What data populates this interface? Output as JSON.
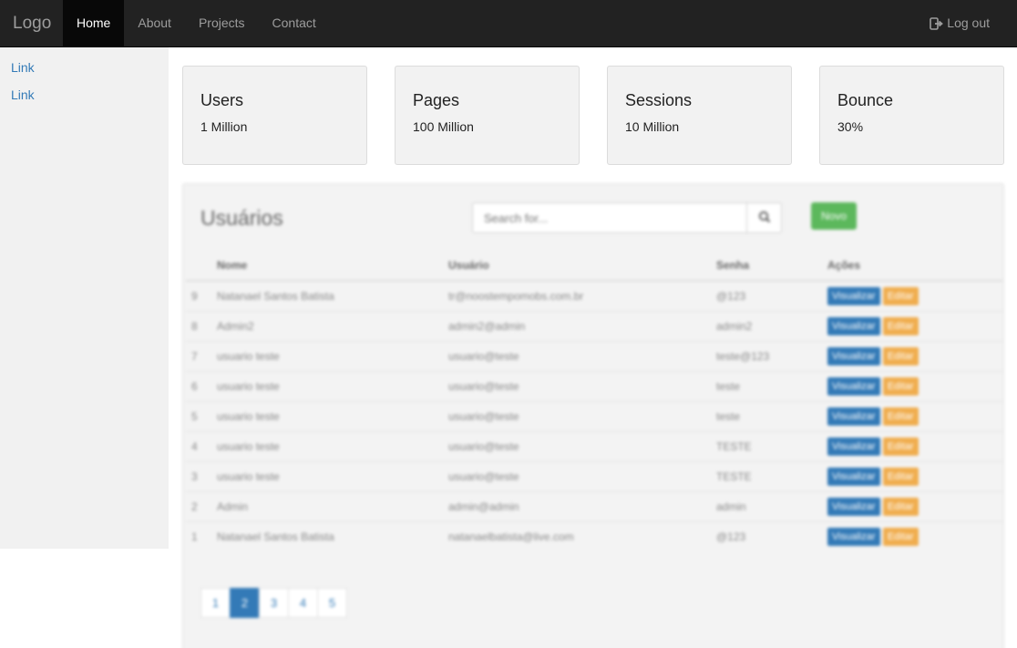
{
  "navbar": {
    "brand": "Logo",
    "items": [
      {
        "label": "Home",
        "active": true
      },
      {
        "label": "About",
        "active": false
      },
      {
        "label": "Projects",
        "active": false
      },
      {
        "label": "Contact",
        "active": false
      }
    ],
    "logout_label": "Log out",
    "logout_icon": "log-out-icon"
  },
  "sidebar": {
    "links": [
      "Link",
      "Link"
    ]
  },
  "stats": [
    {
      "title": "Users",
      "value": "1 Million"
    },
    {
      "title": "Pages",
      "value": "100 Million"
    },
    {
      "title": "Sessions",
      "value": "10 Million"
    },
    {
      "title": "Bounce",
      "value": "30%"
    }
  ],
  "users_panel": {
    "title": "Usuários",
    "search_placeholder": "Search for...",
    "search_icon": "search-icon",
    "new_button": "Novo",
    "columns": [
      "",
      "Nome",
      "Usuário",
      "Senha",
      "Ações"
    ],
    "rows": [
      {
        "id": "9",
        "nome": "Natanael Santos Batista",
        "usuario": "tr@noostempomobs.com.br",
        "senha": "@123"
      },
      {
        "id": "8",
        "nome": "Admin2",
        "usuario": "admin2@admin",
        "senha": "admin2"
      },
      {
        "id": "7",
        "nome": "usuario teste",
        "usuario": "usuario@teste",
        "senha": "teste@123"
      },
      {
        "id": "6",
        "nome": "usuario teste",
        "usuario": "usuario@teste",
        "senha": "teste"
      },
      {
        "id": "5",
        "nome": "usuario teste",
        "usuario": "usuario@teste",
        "senha": "teste"
      },
      {
        "id": "4",
        "nome": "usuario teste",
        "usuario": "usuario@teste",
        "senha": "TESTE"
      },
      {
        "id": "3",
        "nome": "usuario teste",
        "usuario": "usuario@teste",
        "senha": "TESTE"
      },
      {
        "id": "2",
        "nome": "Admin",
        "usuario": "admin@admin",
        "senha": "admin"
      },
      {
        "id": "1",
        "nome": "Natanael Santos Batista",
        "usuario": "natanaelbatista@live.com",
        "senha": "@123"
      }
    ],
    "actions": {
      "view": "Visualizar",
      "edit": "Editar"
    },
    "pagination": {
      "pages": [
        "1",
        "2",
        "3",
        "4",
        "5"
      ],
      "current": "2"
    }
  },
  "colors": {
    "navbar_bg": "#222222",
    "primary": "#337ab7",
    "success": "#5cb85c",
    "warning": "#f0ad4e"
  }
}
